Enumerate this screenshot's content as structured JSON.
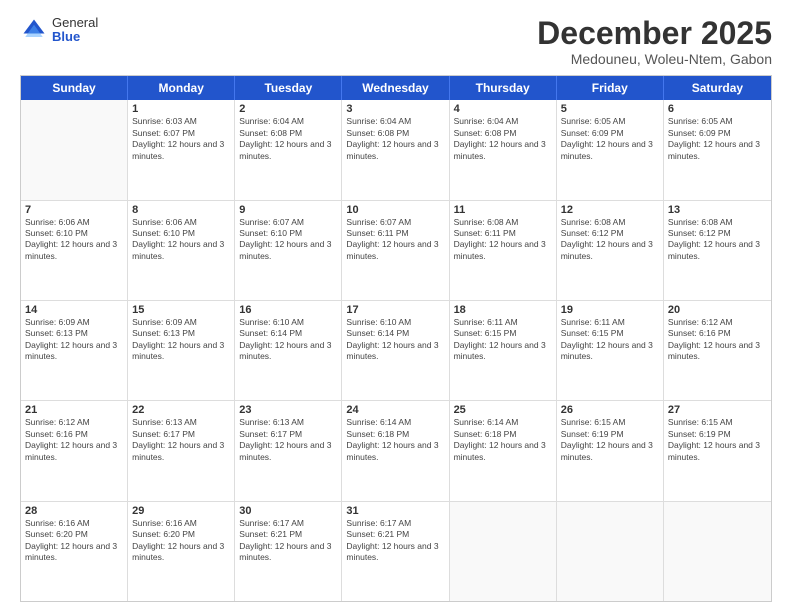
{
  "logo": {
    "general": "General",
    "blue": "Blue"
  },
  "title": "December 2025",
  "location": "Medouneu, Woleu-Ntem, Gabon",
  "days_of_week": [
    "Sunday",
    "Monday",
    "Tuesday",
    "Wednesday",
    "Thursday",
    "Friday",
    "Saturday"
  ],
  "weeks": [
    [
      {
        "day": "",
        "sunrise": "",
        "sunset": "",
        "daylight": ""
      },
      {
        "day": "1",
        "sunrise": "Sunrise: 6:03 AM",
        "sunset": "Sunset: 6:07 PM",
        "daylight": "Daylight: 12 hours and 3 minutes."
      },
      {
        "day": "2",
        "sunrise": "Sunrise: 6:04 AM",
        "sunset": "Sunset: 6:08 PM",
        "daylight": "Daylight: 12 hours and 3 minutes."
      },
      {
        "day": "3",
        "sunrise": "Sunrise: 6:04 AM",
        "sunset": "Sunset: 6:08 PM",
        "daylight": "Daylight: 12 hours and 3 minutes."
      },
      {
        "day": "4",
        "sunrise": "Sunrise: 6:04 AM",
        "sunset": "Sunset: 6:08 PM",
        "daylight": "Daylight: 12 hours and 3 minutes."
      },
      {
        "day": "5",
        "sunrise": "Sunrise: 6:05 AM",
        "sunset": "Sunset: 6:09 PM",
        "daylight": "Daylight: 12 hours and 3 minutes."
      },
      {
        "day": "6",
        "sunrise": "Sunrise: 6:05 AM",
        "sunset": "Sunset: 6:09 PM",
        "daylight": "Daylight: 12 hours and 3 minutes."
      }
    ],
    [
      {
        "day": "7",
        "sunrise": "Sunrise: 6:06 AM",
        "sunset": "Sunset: 6:10 PM",
        "daylight": "Daylight: 12 hours and 3 minutes."
      },
      {
        "day": "8",
        "sunrise": "Sunrise: 6:06 AM",
        "sunset": "Sunset: 6:10 PM",
        "daylight": "Daylight: 12 hours and 3 minutes."
      },
      {
        "day": "9",
        "sunrise": "Sunrise: 6:07 AM",
        "sunset": "Sunset: 6:10 PM",
        "daylight": "Daylight: 12 hours and 3 minutes."
      },
      {
        "day": "10",
        "sunrise": "Sunrise: 6:07 AM",
        "sunset": "Sunset: 6:11 PM",
        "daylight": "Daylight: 12 hours and 3 minutes."
      },
      {
        "day": "11",
        "sunrise": "Sunrise: 6:08 AM",
        "sunset": "Sunset: 6:11 PM",
        "daylight": "Daylight: 12 hours and 3 minutes."
      },
      {
        "day": "12",
        "sunrise": "Sunrise: 6:08 AM",
        "sunset": "Sunset: 6:12 PM",
        "daylight": "Daylight: 12 hours and 3 minutes."
      },
      {
        "day": "13",
        "sunrise": "Sunrise: 6:08 AM",
        "sunset": "Sunset: 6:12 PM",
        "daylight": "Daylight: 12 hours and 3 minutes."
      }
    ],
    [
      {
        "day": "14",
        "sunrise": "Sunrise: 6:09 AM",
        "sunset": "Sunset: 6:13 PM",
        "daylight": "Daylight: 12 hours and 3 minutes."
      },
      {
        "day": "15",
        "sunrise": "Sunrise: 6:09 AM",
        "sunset": "Sunset: 6:13 PM",
        "daylight": "Daylight: 12 hours and 3 minutes."
      },
      {
        "day": "16",
        "sunrise": "Sunrise: 6:10 AM",
        "sunset": "Sunset: 6:14 PM",
        "daylight": "Daylight: 12 hours and 3 minutes."
      },
      {
        "day": "17",
        "sunrise": "Sunrise: 6:10 AM",
        "sunset": "Sunset: 6:14 PM",
        "daylight": "Daylight: 12 hours and 3 minutes."
      },
      {
        "day": "18",
        "sunrise": "Sunrise: 6:11 AM",
        "sunset": "Sunset: 6:15 PM",
        "daylight": "Daylight: 12 hours and 3 minutes."
      },
      {
        "day": "19",
        "sunrise": "Sunrise: 6:11 AM",
        "sunset": "Sunset: 6:15 PM",
        "daylight": "Daylight: 12 hours and 3 minutes."
      },
      {
        "day": "20",
        "sunrise": "Sunrise: 6:12 AM",
        "sunset": "Sunset: 6:16 PM",
        "daylight": "Daylight: 12 hours and 3 minutes."
      }
    ],
    [
      {
        "day": "21",
        "sunrise": "Sunrise: 6:12 AM",
        "sunset": "Sunset: 6:16 PM",
        "daylight": "Daylight: 12 hours and 3 minutes."
      },
      {
        "day": "22",
        "sunrise": "Sunrise: 6:13 AM",
        "sunset": "Sunset: 6:17 PM",
        "daylight": "Daylight: 12 hours and 3 minutes."
      },
      {
        "day": "23",
        "sunrise": "Sunrise: 6:13 AM",
        "sunset": "Sunset: 6:17 PM",
        "daylight": "Daylight: 12 hours and 3 minutes."
      },
      {
        "day": "24",
        "sunrise": "Sunrise: 6:14 AM",
        "sunset": "Sunset: 6:18 PM",
        "daylight": "Daylight: 12 hours and 3 minutes."
      },
      {
        "day": "25",
        "sunrise": "Sunrise: 6:14 AM",
        "sunset": "Sunset: 6:18 PM",
        "daylight": "Daylight: 12 hours and 3 minutes."
      },
      {
        "day": "26",
        "sunrise": "Sunrise: 6:15 AM",
        "sunset": "Sunset: 6:19 PM",
        "daylight": "Daylight: 12 hours and 3 minutes."
      },
      {
        "day": "27",
        "sunrise": "Sunrise: 6:15 AM",
        "sunset": "Sunset: 6:19 PM",
        "daylight": "Daylight: 12 hours and 3 minutes."
      }
    ],
    [
      {
        "day": "28",
        "sunrise": "Sunrise: 6:16 AM",
        "sunset": "Sunset: 6:20 PM",
        "daylight": "Daylight: 12 hours and 3 minutes."
      },
      {
        "day": "29",
        "sunrise": "Sunrise: 6:16 AM",
        "sunset": "Sunset: 6:20 PM",
        "daylight": "Daylight: 12 hours and 3 minutes."
      },
      {
        "day": "30",
        "sunrise": "Sunrise: 6:17 AM",
        "sunset": "Sunset: 6:21 PM",
        "daylight": "Daylight: 12 hours and 3 minutes."
      },
      {
        "day": "31",
        "sunrise": "Sunrise: 6:17 AM",
        "sunset": "Sunset: 6:21 PM",
        "daylight": "Daylight: 12 hours and 3 minutes."
      },
      {
        "day": "",
        "sunrise": "",
        "sunset": "",
        "daylight": ""
      },
      {
        "day": "",
        "sunrise": "",
        "sunset": "",
        "daylight": ""
      },
      {
        "day": "",
        "sunrise": "",
        "sunset": "",
        "daylight": ""
      }
    ]
  ]
}
